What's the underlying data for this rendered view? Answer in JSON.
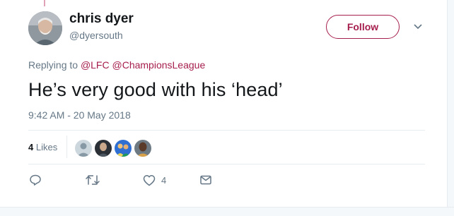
{
  "author": {
    "name": "chris dyer",
    "handle": "@dyersouth"
  },
  "follow_label": "Follow",
  "replying": {
    "prefix": "Replying to",
    "mentions": [
      "@LFC",
      "@ChampionsLeague"
    ]
  },
  "tweet_text": "He’s very good with his ‘head’",
  "timestamp": "9:42 AM - 20 May 2018",
  "likes": {
    "count": "4",
    "label": "Likes"
  },
  "actions": {
    "like_count": "4"
  },
  "icons": {
    "menu": "chevron-down-icon",
    "reply": "reply-icon",
    "retweet": "retweet-icon",
    "like": "heart-icon",
    "dm": "envelope-icon"
  },
  "colors": {
    "accent": "#a61e4d",
    "muted": "#657786",
    "text": "#14171a",
    "divider": "#e6ecf0"
  }
}
